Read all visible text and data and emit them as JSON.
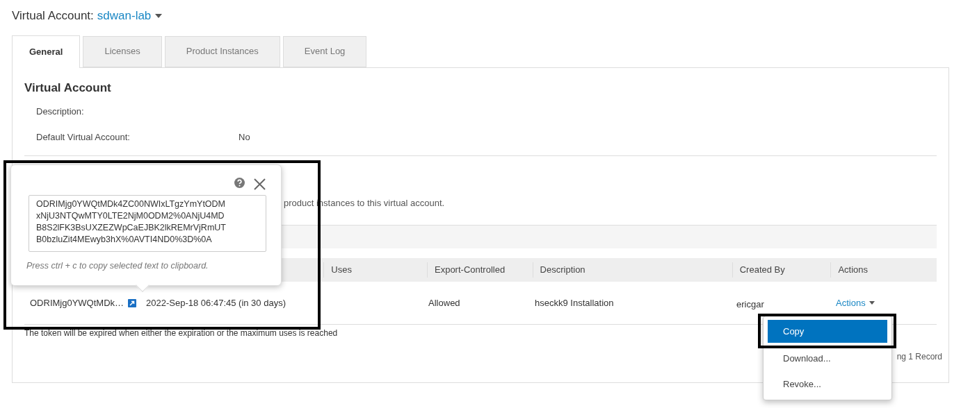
{
  "header": {
    "label": "Virtual Account:",
    "account": "sdwan-lab"
  },
  "tabs": [
    {
      "label": "General",
      "selected": true
    },
    {
      "label": "Licenses",
      "selected": false
    },
    {
      "label": "Product Instances",
      "selected": false
    },
    {
      "label": "Event Log",
      "selected": false
    }
  ],
  "section": {
    "title": "Virtual Account",
    "fields": [
      {
        "label": "Description:"
      },
      {
        "label": "Default Virtual Account:",
        "value": "No"
      }
    ]
  },
  "token_note": "product instances to this virtual account.",
  "table": {
    "columns": [
      "Uses",
      "Export-Controlled",
      "Description",
      "Created By",
      "Actions"
    ],
    "rows": [
      {
        "token": "ODRIMjg0YWQtMDk…",
        "expiration": "2022-Sep-18 06:47:45 (in 30 days)",
        "export_controlled": "Allowed",
        "description": "hseckk9 Installation",
        "created_by": "ericgar",
        "actions": "Actions"
      }
    ]
  },
  "footer_note": "The token will be expired when either the expiration or the maximum uses is reached",
  "record_count": "ng 1 Record",
  "popover": {
    "lines": [
      "ODRIMjg0YWQtMDk4ZC00NWIxLTgzYmYtODM",
      "xNjU3NTQwMTY0LTE2NjM0ODM2%0ANjU4MD",
      "B8S2lFK3BsUXZEZWpCaEJBK2lkREMrVjRmUT",
      "B0bzluZit4MEwyb3hX%0AVTI4ND0%3D%0A"
    ],
    "hint": "Press ctrl + c to copy selected text to clipboard."
  },
  "menu": {
    "items": [
      {
        "label": "Copy",
        "selected": true
      },
      {
        "label": "Download...",
        "selected": false
      },
      {
        "label": "Revoke...",
        "selected": false
      }
    ]
  }
}
